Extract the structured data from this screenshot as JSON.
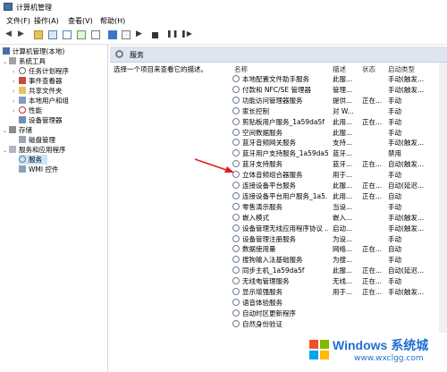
{
  "window": {
    "title": "计算机管理"
  },
  "menu": [
    "文件(F)",
    "操作(A)",
    "查看(V)",
    "帮助(H)"
  ],
  "tree": [
    {
      "label": "计算机管理(本地)",
      "level": 0,
      "icon": "computer-icon"
    },
    {
      "label": "系统工具",
      "level": 1,
      "icon": "tools-icon"
    },
    {
      "label": "任务计划程序",
      "level": 2,
      "icon": "clock-icon"
    },
    {
      "label": "事件查看器",
      "level": 2,
      "icon": "event-viewer-icon"
    },
    {
      "label": "共享文件夹",
      "level": 2,
      "icon": "shared-folder-icon"
    },
    {
      "label": "本地用户和组",
      "level": 2,
      "icon": "users-icon"
    },
    {
      "label": "性能",
      "level": 2,
      "icon": "performance-icon"
    },
    {
      "label": "设备管理器",
      "level": 2,
      "icon": "device-manager-icon"
    },
    {
      "label": "存储",
      "level": 1,
      "icon": "storage-icon"
    },
    {
      "label": "磁盘管理",
      "level": 2,
      "icon": "disk-icon"
    },
    {
      "label": "服务和应用程序",
      "level": 1,
      "icon": "services-apps-icon"
    },
    {
      "label": "服务",
      "level": 2,
      "icon": "gear-icon",
      "selected": true
    },
    {
      "label": "WMI 控件",
      "level": 2,
      "icon": "wmi-icon"
    }
  ],
  "panel": {
    "title": "服务",
    "description": "选择一个项目来查看它的描述。"
  },
  "columns": {
    "name": "名称",
    "desc": "描述",
    "status": "状态",
    "startup": "启动类型"
  },
  "services": [
    {
      "name": "本地配置文件助手服务",
      "desc": "此服...",
      "status": "",
      "startup": "手动(触发..."
    },
    {
      "name": "付款和 NFC/SE 管理器",
      "desc": "管理...",
      "status": "",
      "startup": "手动(触发..."
    },
    {
      "name": "功能访问管理器服务",
      "desc": "提供...",
      "status": "正在...",
      "startup": "手动"
    },
    {
      "name": "家长控制",
      "desc": "对 W...",
      "status": "",
      "startup": "手动"
    },
    {
      "name": "剪贴板用户服务_1a59da5f",
      "desc": "此用...",
      "status": "正在...",
      "startup": "手动"
    },
    {
      "name": "空间数据服务",
      "desc": "此服...",
      "status": "",
      "startup": "手动"
    },
    {
      "name": "蓝牙音频网关服务",
      "desc": "支持...",
      "status": "",
      "startup": "手动(触发..."
    },
    {
      "name": "蓝牙用户支持服务_1a59da5f",
      "desc": "蓝牙...",
      "status": "",
      "startup": "禁用"
    },
    {
      "name": "蓝牙支持服务",
      "desc": "蓝牙...",
      "status": "正在...",
      "startup": "自动(触发..."
    },
    {
      "name": "立体音频组合器服务",
      "desc": "用于...",
      "status": "",
      "startup": "手动"
    },
    {
      "name": "连接设备平台服务",
      "desc": "此服...",
      "status": "正在...",
      "startup": "自动(延迟..."
    },
    {
      "name": "连接设备平台用户服务_1a5...",
      "desc": "此用...",
      "status": "正在...",
      "startup": "自动"
    },
    {
      "name": "零售演示服务",
      "desc": "当设...",
      "status": "",
      "startup": "手动"
    },
    {
      "name": "嵌入模式",
      "desc": "嵌入...",
      "status": "",
      "startup": "手动(触发..."
    },
    {
      "name": "设备管理无线应用程序协议 ...",
      "desc": "启动...",
      "status": "",
      "startup": "手动(触发..."
    },
    {
      "name": "设备管理注册服务",
      "desc": "为设...",
      "status": "",
      "startup": "手动"
    },
    {
      "name": "数据使用量",
      "desc": "网络...",
      "status": "正在...",
      "startup": "自动"
    },
    {
      "name": "搜狗输入法基础服务",
      "desc": "为搜...",
      "status": "",
      "startup": "手动"
    },
    {
      "name": "同步主机_1a59da5f",
      "desc": "此服...",
      "status": "正在...",
      "startup": "自动(延迟..."
    },
    {
      "name": "无线电管理服务",
      "desc": "无线...",
      "status": "正在...",
      "startup": "手动"
    },
    {
      "name": "显示增强服务",
      "desc": "用于...",
      "status": "正在...",
      "startup": "手动(触发..."
    },
    {
      "name": "语音体验服务",
      "desc": "",
      "status": "",
      "startup": ""
    },
    {
      "name": "自动时区更新程序",
      "desc": "",
      "status": "",
      "startup": ""
    },
    {
      "name": "自然身份验证",
      "desc": "",
      "status": "",
      "startup": ""
    }
  ],
  "watermark": {
    "brand": "Windows 系统城",
    "url": "www.wxclgg.com"
  },
  "colors": {
    "selection": "#cce4f7",
    "header": "#dde6f0",
    "arrow": "#e02020",
    "brand": "#1f6fd0"
  }
}
